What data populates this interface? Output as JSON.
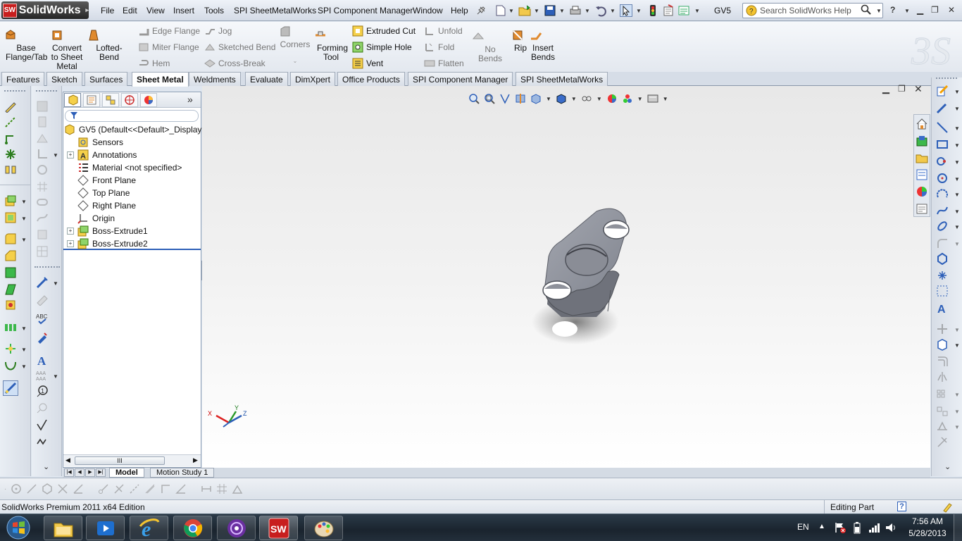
{
  "menubar": {
    "app_name": "SolidWorks",
    "items": [
      "File",
      "Edit",
      "View",
      "Insert",
      "Tools",
      "SPI SheetMetalWorks",
      "SPI Component Manager",
      "Window",
      "Help"
    ],
    "document_name": "GV5",
    "search_placeholder": "Search SolidWorks Help",
    "help_label": "?"
  },
  "command_manager": {
    "base_flange": "Base Flange/Tab",
    "convert": "Convert to Sheet Metal",
    "lofted_bend": "Lofted-Bend",
    "edge_flange": "Edge Flange",
    "miter_flange": "Miter Flange",
    "hem": "Hem",
    "jog": "Jog",
    "sketched_bend": "Sketched Bend",
    "cross_break": "Cross-Break",
    "corners": "Corners",
    "forming_tool": "Forming Tool",
    "extruded_cut": "Extruded Cut",
    "simple_hole": "Simple Hole",
    "vent": "Vent",
    "unfold": "Unfold",
    "fold": "Fold",
    "flatten": "Flatten",
    "no_bends": "No Bends",
    "rip": "Rip",
    "insert_bends": "Insert Bends"
  },
  "tabs": [
    "Features",
    "Sketch",
    "Surfaces",
    "Sheet Metal",
    "Weldments",
    "Evaluate",
    "DimXpert",
    "Office Products",
    "SPI Component Manager",
    "SPI SheetMetalWorks"
  ],
  "active_tab": "Sheet Metal",
  "feature_tree": {
    "root": "GV5  (Default<<Default>_Display",
    "items": [
      {
        "label": "Sensors",
        "icon": "sensor-icon",
        "expandable": false
      },
      {
        "label": "Annotations",
        "icon": "annotations-icon",
        "expandable": true
      },
      {
        "label": "Material <not specified>",
        "icon": "material-icon",
        "expandable": false
      },
      {
        "label": "Front Plane",
        "icon": "plane-icon",
        "expandable": false
      },
      {
        "label": "Top Plane",
        "icon": "plane-icon",
        "expandable": false
      },
      {
        "label": "Right Plane",
        "icon": "plane-icon",
        "expandable": false
      },
      {
        "label": "Origin",
        "icon": "origin-icon",
        "expandable": false
      },
      {
        "label": "Boss-Extrude1",
        "icon": "extrude-icon",
        "expandable": true
      },
      {
        "label": "Boss-Extrude2",
        "icon": "extrude-icon",
        "expandable": true
      }
    ],
    "hscroll_label": "III"
  },
  "bottom_tabs": [
    "Model",
    "Motion Study 1"
  ],
  "triad": {
    "x": "X",
    "y": "Y",
    "z": "Z"
  },
  "status": {
    "left": "SolidWorks Premium 2011 x64 Edition",
    "right": "Editing Part",
    "help": "?"
  },
  "taskbar": {
    "language": "EN",
    "time": "7:56 AM",
    "date": "5/28/2013"
  },
  "colors": {
    "accent_red": "#c81e1e",
    "part_gray": "#8e929c",
    "tab_active": "#ffffff"
  }
}
